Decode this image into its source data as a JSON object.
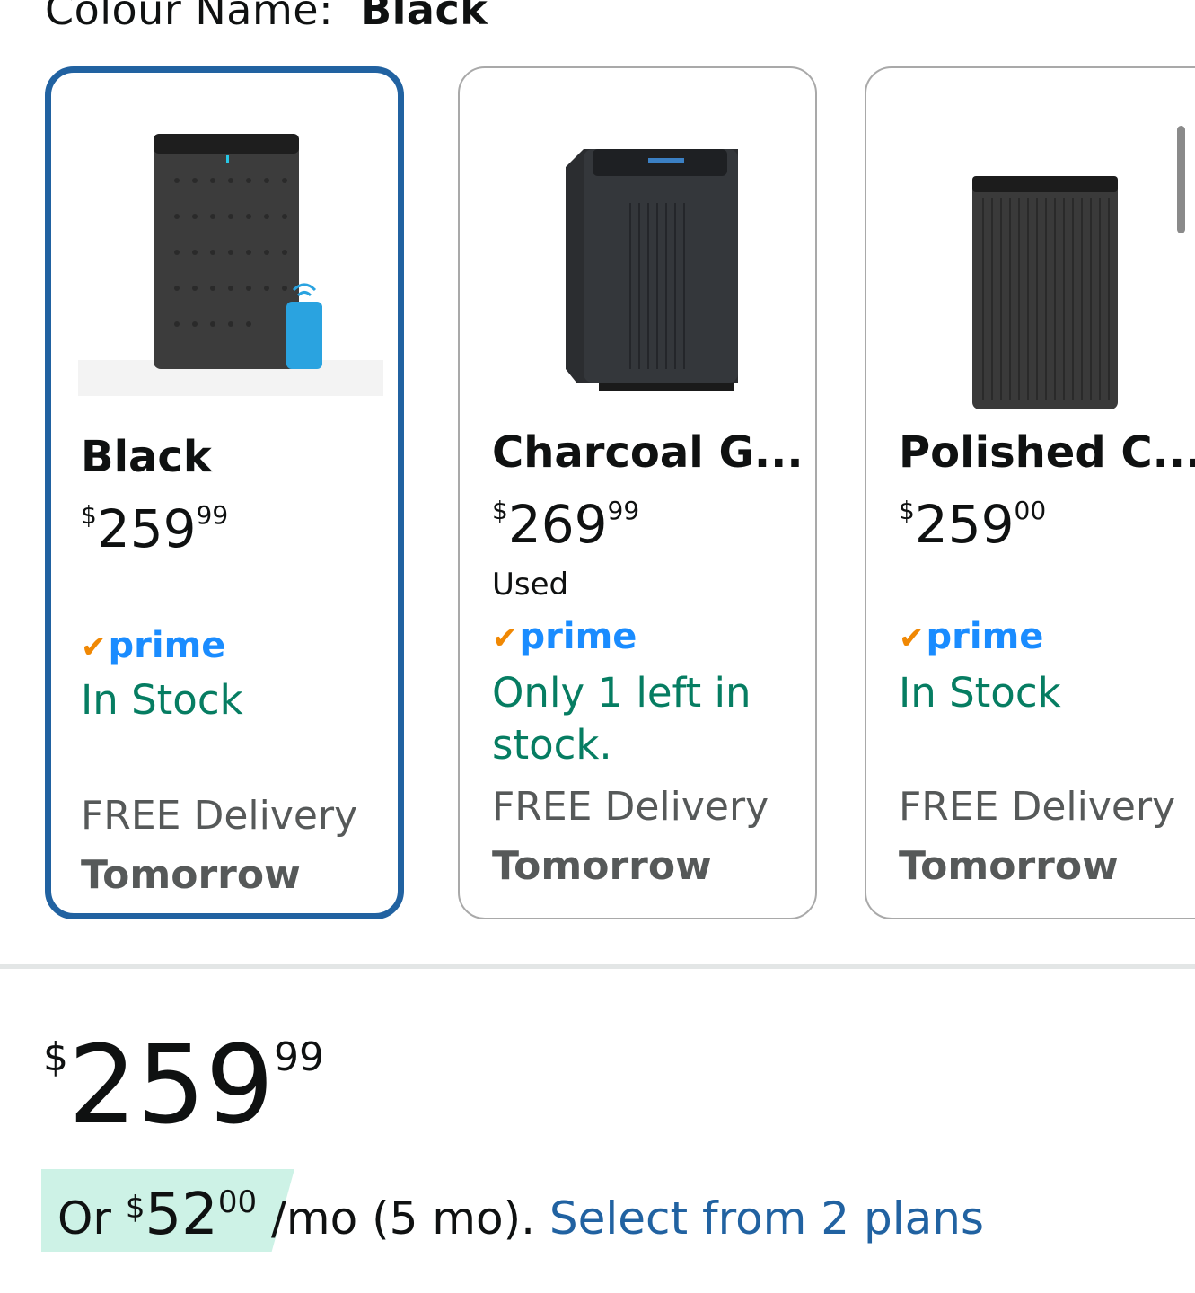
{
  "header": {
    "label": "Colour Name:",
    "value": "Black"
  },
  "options": [
    {
      "name": "Black",
      "price_symbol": "$",
      "price_whole": "259",
      "price_fraction": "99",
      "condition": "",
      "prime": "prime",
      "stock": "In Stock",
      "delivery": "FREE Delivery",
      "delivery_when": "Tomorrow",
      "selected": true
    },
    {
      "name": "Charcoal G...",
      "price_symbol": "$",
      "price_whole": "269",
      "price_fraction": "99",
      "condition": "Used",
      "prime": "prime",
      "stock": "Only 1 left in stock.",
      "delivery": "FREE Delivery",
      "delivery_when": "Tomorrow",
      "selected": false
    },
    {
      "name": "Polished C...",
      "price_symbol": "$",
      "price_whole": "259",
      "price_fraction": "00",
      "condition": "",
      "prime": "prime",
      "stock": "In Stock",
      "delivery": "FREE Delivery",
      "delivery_when": "Tomorrow",
      "selected": false
    }
  ],
  "price": {
    "symbol": "$",
    "whole": "259",
    "fraction": "99"
  },
  "installment": {
    "prefix": "Or ",
    "symbol": "$",
    "whole": "52",
    "fraction": "00",
    "suffix": " /mo (5 mo). ",
    "link": "Select from 2 plans"
  },
  "colors": {
    "selected_border": "#2162a1",
    "stock_green": "#067d62",
    "prime_blue": "#1a8cff",
    "link_blue": "#2162a1",
    "highlight": "#cdf2e6"
  }
}
